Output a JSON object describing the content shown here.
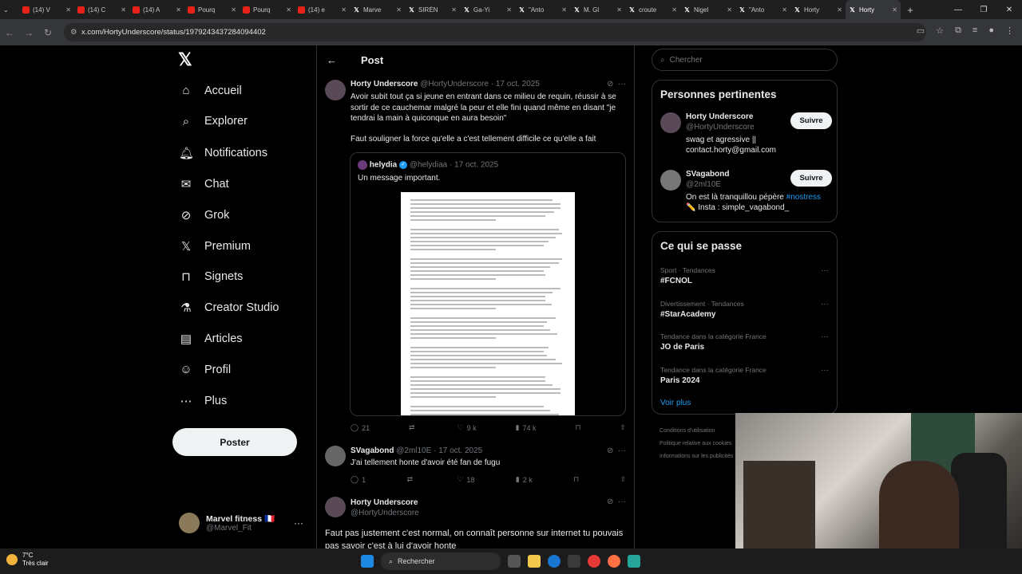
{
  "browser": {
    "tabs": [
      {
        "title": "(14) V",
        "icon": "youtube"
      },
      {
        "title": "(14) C",
        "icon": "youtube"
      },
      {
        "title": "(14) A",
        "icon": "youtube"
      },
      {
        "title": "Pourq",
        "icon": "youtube"
      },
      {
        "title": "Pourq",
        "icon": "youtube"
      },
      {
        "title": "(14) e",
        "icon": "youtube"
      },
      {
        "title": "Marve",
        "icon": "x"
      },
      {
        "title": "SIRÈN",
        "icon": "x"
      },
      {
        "title": "Ga-Yi",
        "icon": "x"
      },
      {
        "title": "\"Anto",
        "icon": "x"
      },
      {
        "title": "M. Gl",
        "icon": "x"
      },
      {
        "title": "croute",
        "icon": "x"
      },
      {
        "title": "Nigel",
        "icon": "x"
      },
      {
        "title": "\"Anto",
        "icon": "x"
      },
      {
        "title": "Horty",
        "icon": "x"
      },
      {
        "title": "Horty",
        "icon": "x",
        "active": true
      }
    ],
    "url": "x.com/HortyUnderscore/status/1979243437284094402"
  },
  "sidebar": {
    "items": [
      {
        "label": "Accueil",
        "icon": "home-icon"
      },
      {
        "label": "Explorer",
        "icon": "search-icon"
      },
      {
        "label": "Notifications",
        "icon": "bell-icon"
      },
      {
        "label": "Chat",
        "icon": "mail-icon"
      },
      {
        "label": "Grok",
        "icon": "grok-icon"
      },
      {
        "label": "Premium",
        "icon": "x-icon"
      },
      {
        "label": "Signets",
        "icon": "bookmark-icon"
      },
      {
        "label": "Creator Studio",
        "icon": "flask-icon"
      },
      {
        "label": "Articles",
        "icon": "article-icon"
      },
      {
        "label": "Profil",
        "icon": "person-icon"
      },
      {
        "label": "Plus",
        "icon": "more-icon"
      }
    ],
    "post_button": "Poster",
    "account": {
      "name": "Marvel fitness 🇫🇷",
      "handle": "@Marvel_Fit"
    }
  },
  "main": {
    "title": "Post",
    "tweet": {
      "name": "Horty Underscore",
      "handle": "@HortyUnderscore",
      "date": "17 oct. 2025",
      "text1": "Avoir subit tout ça si jeune en entrant dans ce milieu de requin, réussir à se sortir de ce cauchemar malgré la peur et elle fini quand même en disant \"je tendrai la main à quiconque en aura besoin\"",
      "text2": "Faut souligner la force qu'elle a c'est tellement difficile ce qu'elle a fait",
      "quote": {
        "name": "helydia",
        "handle": "@helydiaa",
        "date": "17 oct. 2025",
        "text": "Un message important."
      },
      "stats": {
        "replies": "21",
        "retweets": "",
        "likes": "9 k",
        "views": "74 k"
      }
    },
    "reply1": {
      "name": "SVagabond",
      "handle": "@2ml10E",
      "date": "17 oct. 2025",
      "text": "J'ai tellement honte d'avoir été fan de fugu",
      "stats": {
        "replies": "1",
        "retweets": "",
        "likes": "18",
        "views": "2 k"
      }
    },
    "reply2": {
      "name": "Horty Underscore",
      "handle": "@HortyUnderscore",
      "text": "Faut pas justement c'est normal, on connaît personne sur internet tu pouvais pas savoir c'est à lui d'avoir honte"
    }
  },
  "right": {
    "search_placeholder": "Chercher",
    "relevant_title": "Personnes pertinentes",
    "people": [
      {
        "name": "Horty Underscore",
        "handle": "@HortyUnderscore",
        "bio": "swag et agressive || contact.horty@gmail.com",
        "button": "Suivre"
      },
      {
        "name": "SVagabond",
        "handle": "@2ml10E",
        "bio": "On est là tranquillou pépère ",
        "hashtag": "#nostress",
        "bio2": "✏️ Insta : simple_vagabond_",
        "button": "Suivre"
      }
    ],
    "trends_title": "Ce qui se passe",
    "trends": [
      {
        "category": "Sport · Tendances",
        "name": "#FCNOL"
      },
      {
        "category": "Divertissement · Tendances",
        "name": "#StarAcademy"
      },
      {
        "category": "Tendance dans la catégorie France",
        "name": "JO de Paris"
      },
      {
        "category": "Tendance dans la catégorie France",
        "name": "Paris 2024"
      }
    ],
    "see_more": "Voir plus",
    "footer": [
      "Conditions d'utilisation",
      "Politique relative aux cookies",
      "Informations sur les publicités"
    ]
  },
  "taskbar": {
    "temp": "7°C",
    "weather": "Très clair",
    "search": "Rechercher"
  }
}
